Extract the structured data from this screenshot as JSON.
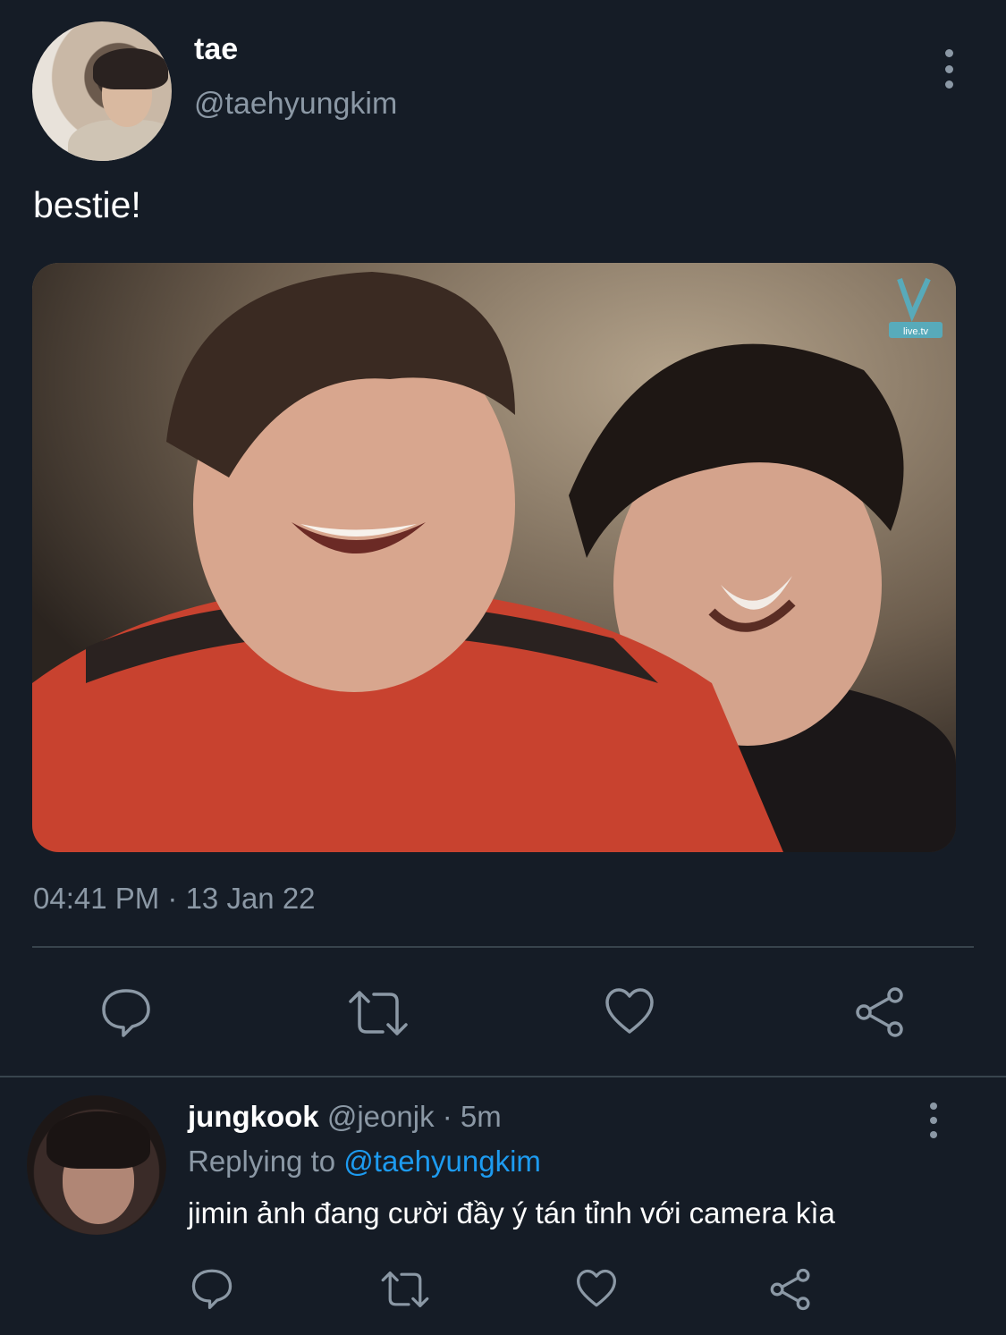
{
  "tweet": {
    "display_name": "tae",
    "handle": "@taehyungkim",
    "text": "bestie!",
    "timestamp": "04:41 PM · 13 Jan 22",
    "photo_watermark": "V live.tv"
  },
  "reply": {
    "display_name": "jungkook",
    "handle": "@jeonjk",
    "separator": "·",
    "time": "5m",
    "replying_prefix": "Replying to",
    "replying_mention": "@taehyungkim",
    "text": "jimin ảnh đang cười đầy ý tán tỉnh với camera kìa"
  },
  "icons": {
    "more": "more-vertical-icon",
    "reply": "reply-icon",
    "retweet": "retweet-icon",
    "like": "heart-icon",
    "share": "share-icon"
  },
  "colors": {
    "background": "#151c26",
    "secondary_text": "#8b98a5",
    "link": "#1d9bf0",
    "divider": "#38444d"
  }
}
